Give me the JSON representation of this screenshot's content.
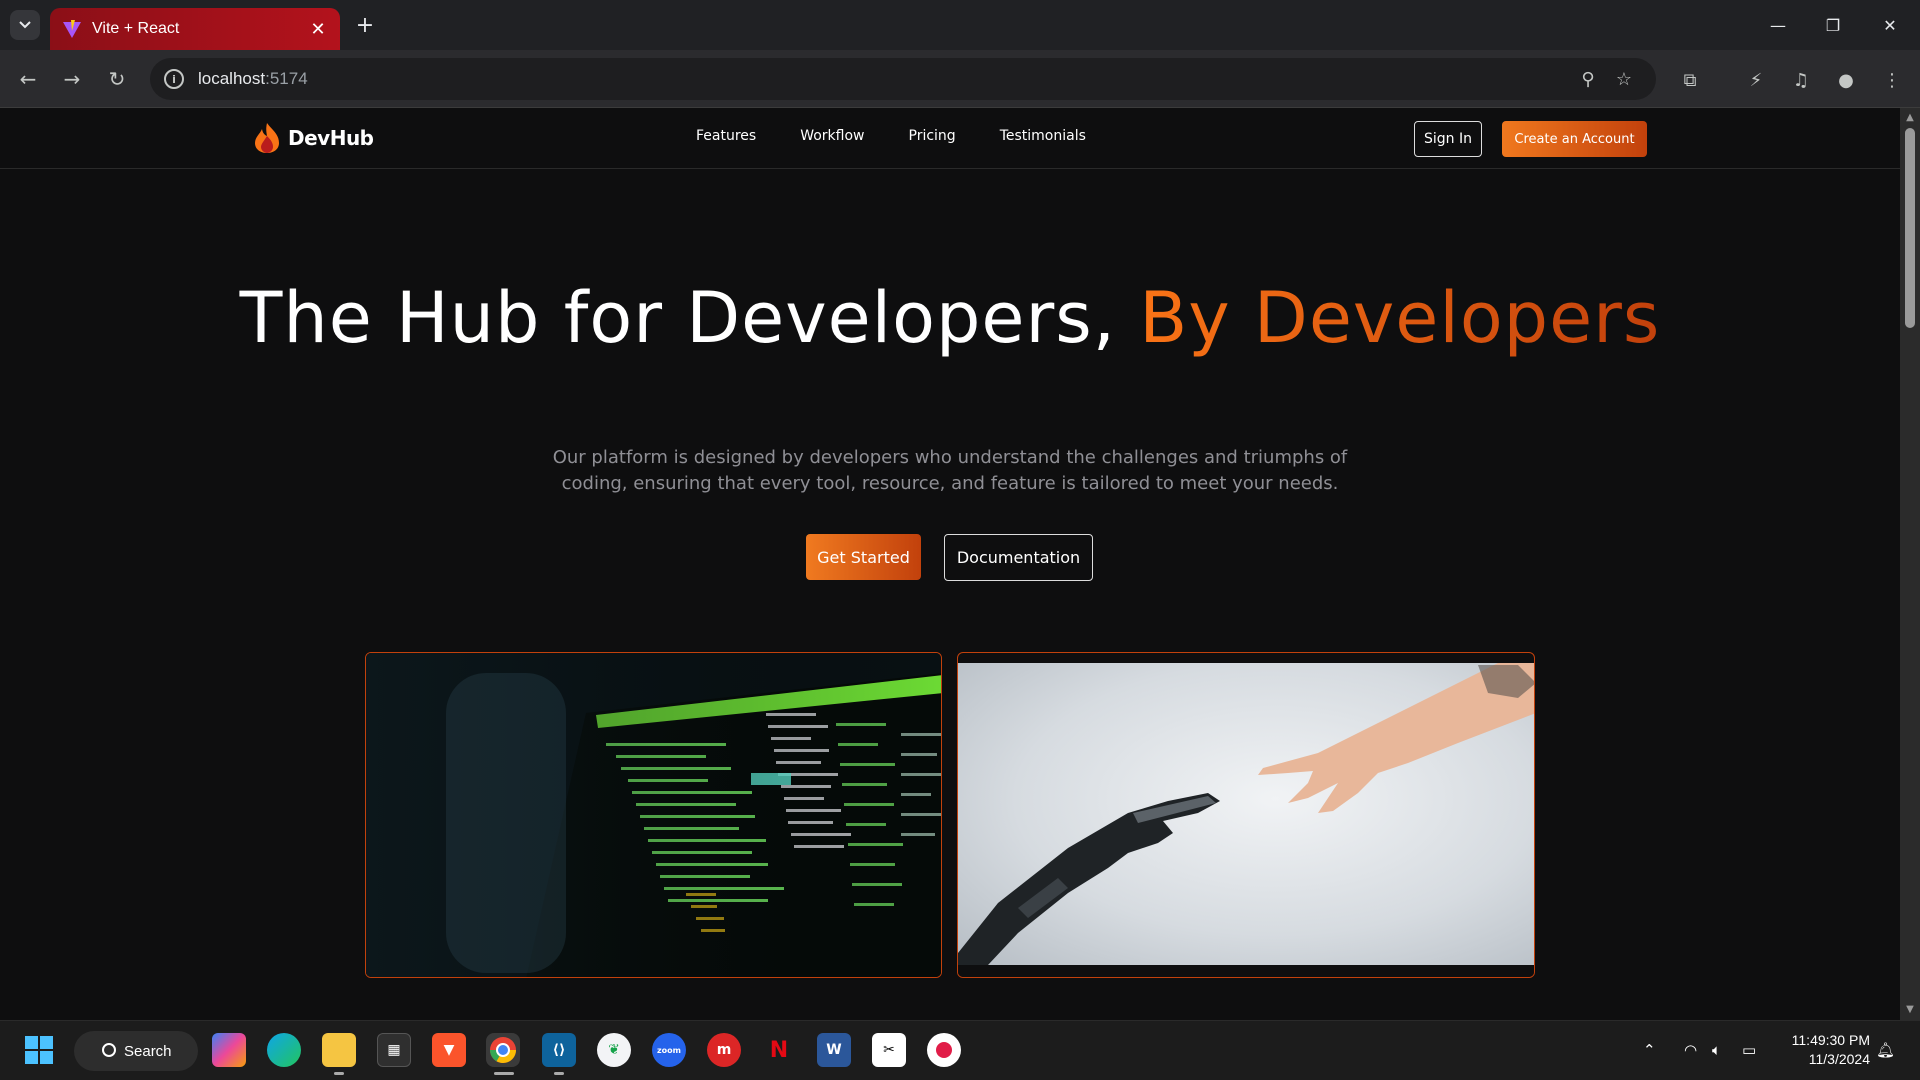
{
  "browser": {
    "tab_title": "Vite + React",
    "url_host": "localhost",
    "url_port": ":5174"
  },
  "site": {
    "brand": "DevHub",
    "nav": [
      "Features",
      "Workflow",
      "Pricing",
      "Testimonials"
    ],
    "sign_in": "Sign In",
    "create_account": "Create an Account"
  },
  "hero": {
    "title_main": "The Hub for Developers, ",
    "title_accent": "By Developers",
    "subtitle": "Our platform is designed by developers who understand the challenges and triumphs of coding, ensuring that every tool, resource, and feature is tailored to meet your needs.",
    "cta_primary": "Get Started",
    "cta_secondary": "Documentation"
  },
  "taskbar": {
    "search_label": "Search",
    "time": "11:49:30 PM",
    "date": "11/3/2024"
  },
  "colors": {
    "accent": "#f97316",
    "accent_dark": "#c2410c",
    "tab_red": "#b3121c"
  }
}
